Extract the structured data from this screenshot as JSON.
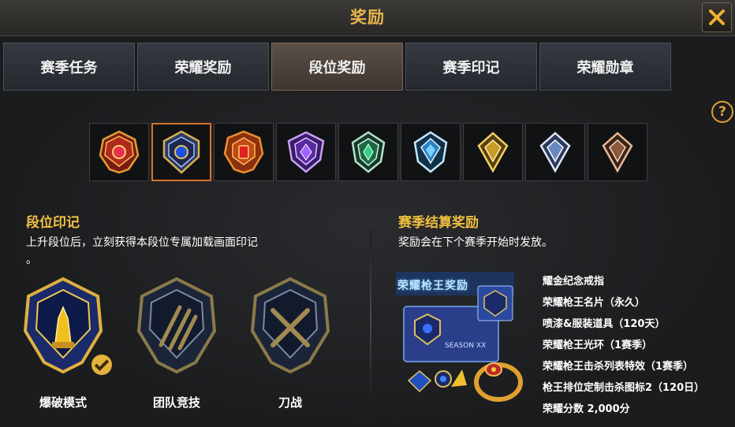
{
  "window": {
    "title": "奖励"
  },
  "tabs": [
    {
      "label": "赛季任务"
    },
    {
      "label": "荣耀奖励"
    },
    {
      "label": "段位奖励"
    },
    {
      "label": "赛季印记"
    },
    {
      "label": "荣耀勋章"
    }
  ],
  "active_tab": 2,
  "help_glyph": "?",
  "ranks": [
    {
      "icon": "rank-red-icon"
    },
    {
      "icon": "rank-blue-gold-icon"
    },
    {
      "icon": "rank-orange-icon"
    },
    {
      "icon": "rank-purple-icon"
    },
    {
      "icon": "rank-green-icon"
    },
    {
      "icon": "rank-diamond-icon"
    },
    {
      "icon": "rank-gold-icon"
    },
    {
      "icon": "rank-silver-icon"
    },
    {
      "icon": "rank-bronze-icon"
    }
  ],
  "selected_rank": 1,
  "left": {
    "title": "段位印记",
    "description": "上升段位后，立刻获得本段位专属加载画面印记",
    "description_tail": "。",
    "emblems": [
      {
        "label": "爆破模式",
        "unlocked": true
      },
      {
        "label": "团队竞技",
        "unlocked": false
      },
      {
        "label": "刀战",
        "unlocked": false
      }
    ]
  },
  "right": {
    "title": "赛季结算奖励",
    "description": "奖励会在下个赛季开始时发放。",
    "banner_text": "荣耀枪王奖励",
    "season_text": "SEASON XX",
    "rewards": [
      "耀金纪念戒指",
      "荣耀枪王名片（永久）",
      "喷漆&服装道具（120天）",
      "荣耀枪王光环（1赛季）",
      "荣耀枪王击杀列表特效（1赛季）",
      "枪王排位定制击杀图标2（120日）",
      "荣耀分数 2,000分"
    ]
  },
  "colors": {
    "accent_gold": "#e8b54c",
    "section_title": "#f0c040",
    "active_rank_border": "#d9722a"
  }
}
